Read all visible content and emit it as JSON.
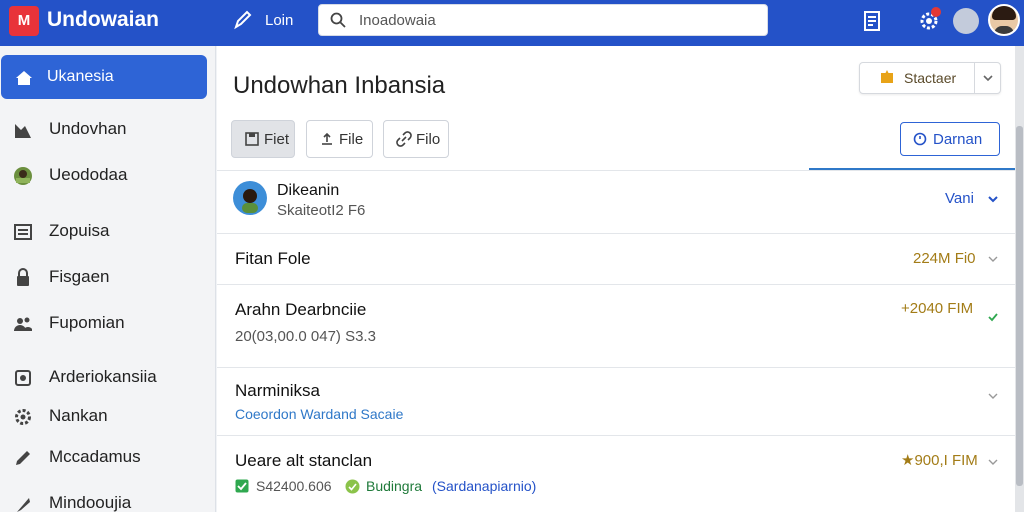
{
  "app": {
    "title": "Undowaian",
    "logo_glyph": "M",
    "top_tab": "Loin",
    "search_value": "Inoadowaia"
  },
  "sidebar": {
    "items": [
      {
        "label": "Ukanesia",
        "icon": "home-icon",
        "active": true
      },
      {
        "label": "Undovhan",
        "icon": "chart-icon"
      },
      {
        "label": "Ueododaa",
        "icon": "landscape-icon"
      },
      {
        "label": "Zopuisa",
        "icon": "list-icon"
      },
      {
        "label": "Fisgaen",
        "icon": "lock-icon"
      },
      {
        "label": "Fupomian",
        "icon": "users-icon"
      },
      {
        "label": "Arderiokansiia",
        "icon": "box-icon"
      },
      {
        "label": "Nankan",
        "icon": "gear-icon"
      },
      {
        "label": "Mccadamus",
        "icon": "pencil-icon"
      },
      {
        "label": "Mindooujia",
        "icon": "feather-icon"
      }
    ]
  },
  "main": {
    "title": "Undowhan Inbansia",
    "primary_button": "Stactaer",
    "toolbar": {
      "tabs": [
        "Fiet",
        "File",
        "Filo"
      ],
      "outline_button": "Darnan"
    },
    "rows": [
      {
        "title": "Dikeanin",
        "sub": "SkaiteotI2 F6",
        "meta": "Vani",
        "type": "header"
      },
      {
        "title": "Fitan Fole",
        "meta": "224M Fi0"
      },
      {
        "title": "Arahn Dearbnciie",
        "sub": "20(03,00.0 047) S3.3",
        "meta": "+2040 FIM"
      },
      {
        "title": "Narminiksa",
        "sub": "Coeordon Wardand Sacaie"
      },
      {
        "title": "Ueare alt stanclan",
        "sub_a": "S42400.606",
        "sub_b": "Budingra",
        "sub_c": "(Sardanapiarnio)",
        "meta": "★900,I FIM"
      }
    ]
  },
  "colors": {
    "topbar": "#2452c8",
    "accent": "#2e64d6",
    "meta_gold": "#a37c17",
    "link_blue": "#2f78c8",
    "success_green": "#2fa84f"
  }
}
